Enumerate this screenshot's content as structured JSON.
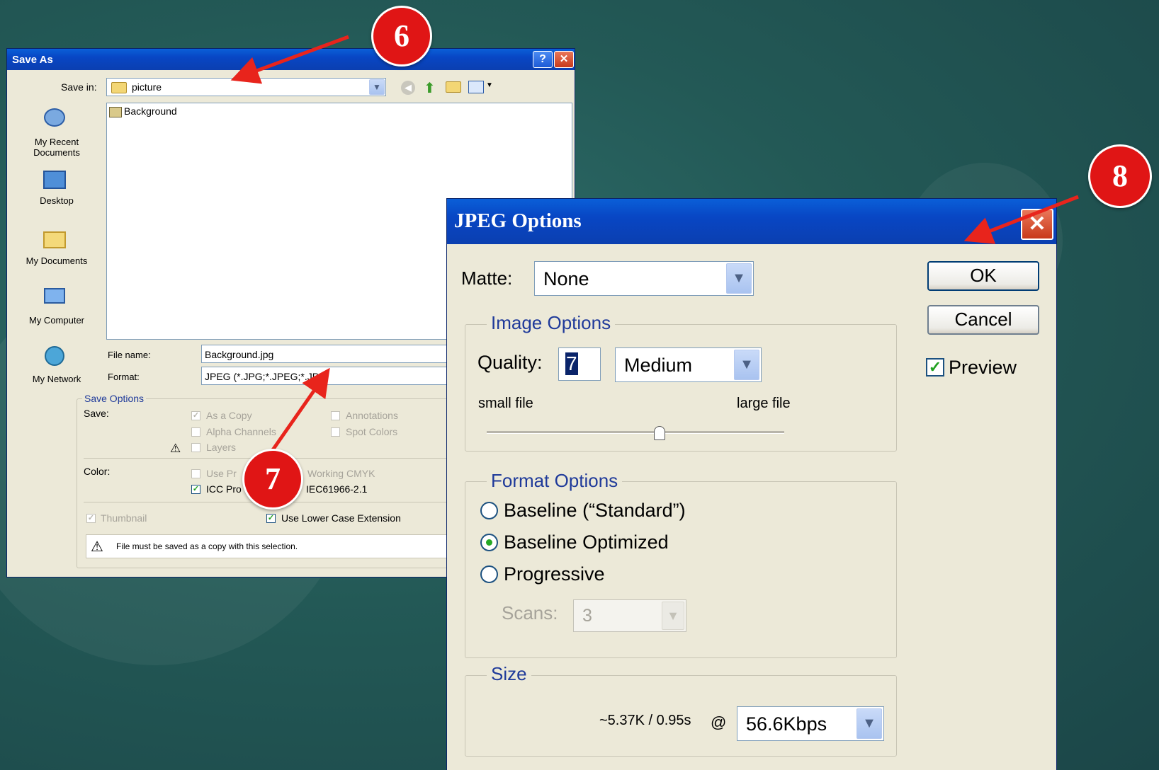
{
  "save_as": {
    "title": "Save As",
    "help_btn": "?",
    "close_btn": "✕",
    "save_in_label": "Save in:",
    "save_in_value": "picture",
    "places": [
      "My Recent Documents",
      "Desktop",
      "My Documents",
      "My Computer",
      "My Network"
    ],
    "files": [
      "Background"
    ],
    "file_name_label": "File name:",
    "file_name_value": "Background.jpg",
    "format_label": "Format:",
    "format_value": "JPEG (*.JPG;*.JPEG;*.JPE)",
    "save_options_title": "Save Options",
    "save_label": "Save:",
    "as_a_copy": "As a Copy",
    "alpha_channels": "Alpha Channels",
    "layers": "Layers",
    "annotations": "Annotations",
    "spot_colors": "Spot Colors",
    "color_label": "Color:",
    "use_proof": "Use Pr",
    "working_cmyk": "Working CMYK",
    "icc_profile": "ICC Pro",
    "icc_value": "IEC61966-2.1",
    "thumbnail": "Thumbnail",
    "lower_case_ext": "Use Lower Case Extension",
    "warning_text": "File must be saved as a copy with this selection."
  },
  "jpeg_options": {
    "title": "JPEG Options",
    "close_btn": "✕",
    "matte_label": "Matte:",
    "matte_value": "None",
    "image_options_title": "Image Options",
    "quality_label": "Quality:",
    "quality_value": "7",
    "quality_preset": "Medium",
    "small_file": "small file",
    "large_file": "large file",
    "quality_slider_fraction": 0.58,
    "format_options_title": "Format Options",
    "baseline_standard": "Baseline (“Standard”)",
    "baseline_optimized": "Baseline Optimized",
    "progressive": "Progressive",
    "scans_label": "Scans:",
    "scans_value": "3",
    "size_title": "Size",
    "size_estimate": "~5.37K / 0.95s",
    "at_sign": "@",
    "speed_value": "56.6Kbps",
    "ok": "OK",
    "cancel": "Cancel",
    "preview": "Preview"
  },
  "callouts": {
    "six": "6",
    "seven": "7",
    "eight": "8"
  },
  "colors": {
    "titlebar": "#0846c4",
    "callout_red": "#e01515",
    "arrow_red": "#e8241c",
    "background": "#235956"
  }
}
